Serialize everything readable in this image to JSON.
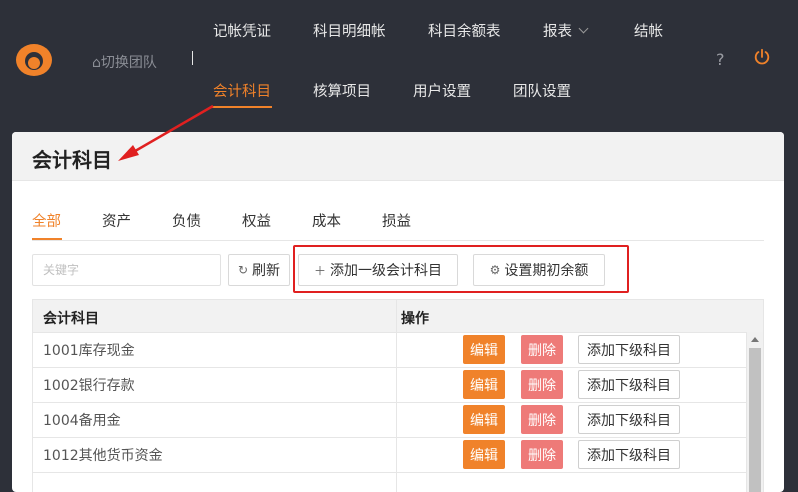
{
  "header": {
    "switch_team": "⌂切换团队",
    "nav_row1": [
      "记帐凭证",
      "科目明细帐",
      "科目余额表",
      "报表",
      "结帐"
    ],
    "nav_row2": [
      "会计科目",
      "核算项目",
      "用户设置",
      "团队设置"
    ],
    "active_nav": "会计科目",
    "help": "?",
    "accent_color": "#f0822a"
  },
  "page": {
    "title": "会计科目"
  },
  "tabs": [
    "全部",
    "资产",
    "负债",
    "权益",
    "成本",
    "损益"
  ],
  "active_tab": "全部",
  "toolbar": {
    "search_placeholder": "关键字",
    "refresh_label": "刷新",
    "add_top_label": "添加一级会计科目",
    "set_opening_label": "设置期初余额"
  },
  "table": {
    "headers": [
      "会计科目",
      "操作"
    ],
    "rows": [
      {
        "name": "1001库存现金"
      },
      {
        "name": "1002银行存款"
      },
      {
        "name": "1004备用金"
      },
      {
        "name": "1012其他货币资金"
      },
      {
        "name": ""
      }
    ],
    "actions": {
      "edit": "编辑",
      "delete": "删除",
      "add_child": "添加下级科目"
    }
  }
}
